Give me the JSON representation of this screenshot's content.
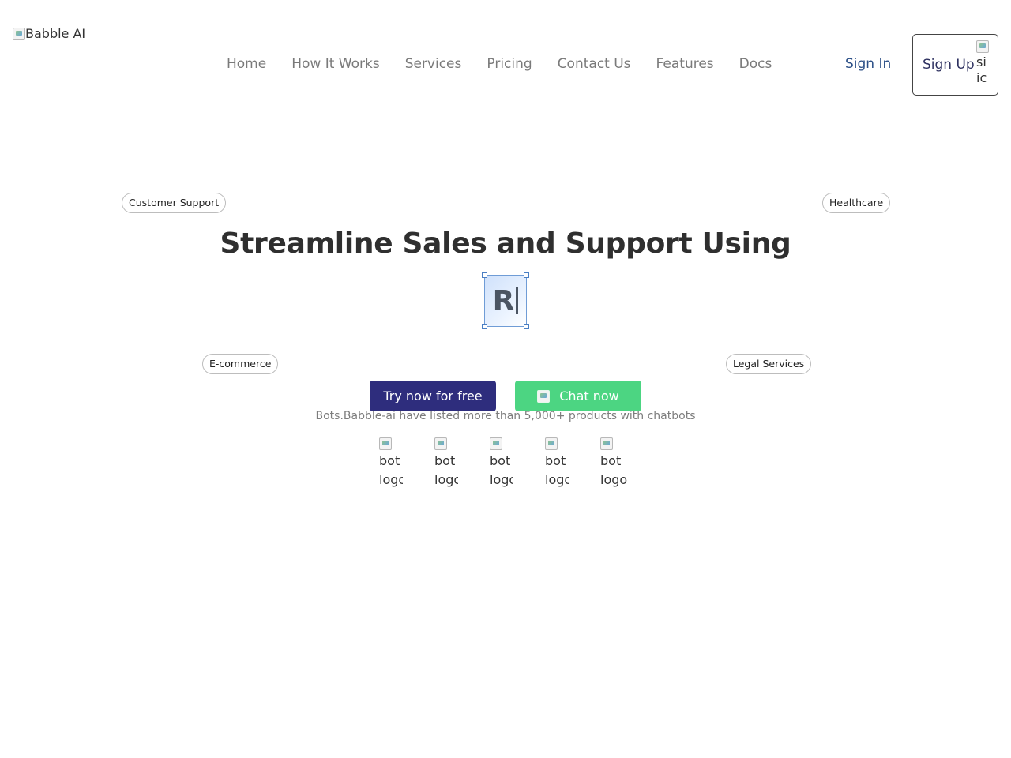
{
  "header": {
    "logo_alt": "Babble AI",
    "nav": [
      "Home",
      "How It Works",
      "Services",
      "Pricing",
      "Contact Us",
      "Features",
      "Docs"
    ],
    "sign_in": "Sign In",
    "sign_up": "Sign Up",
    "sign_up_icon_alt_1": "si",
    "sign_up_icon_alt_2": "ic"
  },
  "hero": {
    "chips": [
      "Customer Support",
      "Healthcare",
      "E-commerce",
      "Legal Services"
    ],
    "headline": "Streamline Sales and Support Using",
    "typed_text": "R",
    "try_button": "Try now for free",
    "chat_button": "Chat now",
    "listed_text": "Bots.Babble-ai have listed more than 5,000+ products with chatbots",
    "bot_logos": [
      {
        "line1": "bot",
        "line2": "logo"
      },
      {
        "line1": "bot",
        "line2": "logo"
      },
      {
        "line1": "bot",
        "line2": "logo"
      },
      {
        "line1": "bot",
        "line2": "logo"
      },
      {
        "line1": "bot",
        "line2": "logo"
      }
    ]
  },
  "colors": {
    "primary_button": "#2e2d7d",
    "chat_button": "#4cd582",
    "sign_in_link": "#2a4e86",
    "headline": "#2f2f2f"
  },
  "icons": {
    "broken_image": "broken-image-icon"
  }
}
